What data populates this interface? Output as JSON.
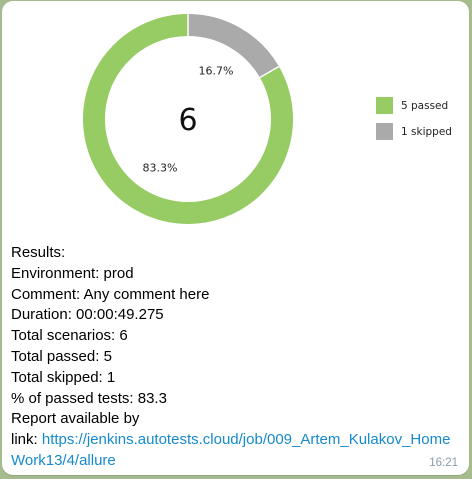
{
  "message": {
    "results_label": "Results:",
    "environment_label": "Environment:",
    "environment_value": "prod",
    "comment_label": "Comment:",
    "comment_value": "Any comment here",
    "duration_label": "Duration:",
    "duration_value": "00:00:49.275",
    "total_scenarios_label": "Total scenarios:",
    "total_scenarios_value": "6",
    "total_passed_label": "Total passed:",
    "total_passed_value": "5",
    "total_skipped_label": "Total skipped:",
    "total_skipped_value": "1",
    "percent_passed_label": "% of passed tests:",
    "percent_passed_value": "83.3",
    "report_label_line1": "Report available by",
    "report_label_line2": "link:",
    "report_url": "https://jenkins.autotests.cloud/job/009_Artem_Kulakov_HomeWork13/4/allure",
    "time": "16:21"
  },
  "colors": {
    "passed": "#97cc64",
    "skipped": "#aaaaaa",
    "link": "#168acd",
    "background": "#a7bc8e"
  },
  "chart_data": {
    "type": "pie",
    "style": "donut",
    "center_label": "6",
    "slices": [
      {
        "label": "5 passed",
        "value": 5,
        "percent_label": "83.3%",
        "color": "#97cc64"
      },
      {
        "label": "1 skipped",
        "value": 1,
        "percent_label": "16.7%",
        "color": "#aaaaaa"
      }
    ],
    "legend_position": "right"
  }
}
